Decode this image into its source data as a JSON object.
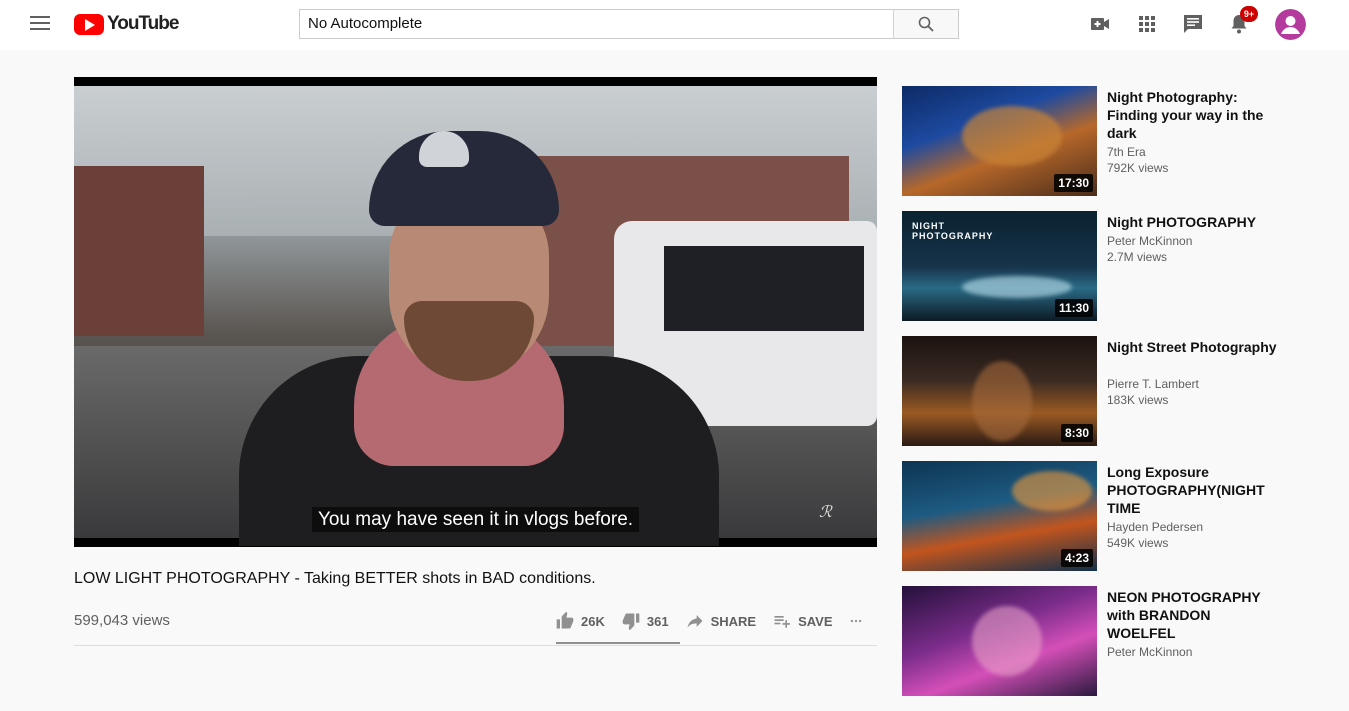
{
  "header": {
    "logo_text": "YouTube",
    "search_value": "No Autocomplete",
    "notification_count": "9+"
  },
  "video": {
    "caption": "You may have seen it in vlogs before.",
    "title": "LOW LIGHT PHOTOGRAPHY - Taking BETTER shots in BAD conditions.",
    "views": "599,043 views",
    "likes": "26K",
    "dislikes": "361",
    "share_label": "SHARE",
    "save_label": "SAVE"
  },
  "recommendations": [
    {
      "title": "Night Photography: Finding your way in the dark",
      "channel": "7th Era",
      "views": "792K views",
      "duration": "17:30"
    },
    {
      "title": "Night PHOTOGRAPHY",
      "channel": "Peter McKinnon",
      "views": "2.7M views",
      "duration": "11:30",
      "thumb_text": "NIGHT PHOTOGRAPHY"
    },
    {
      "title": "Night Street Photography",
      "channel": "Pierre T. Lambert",
      "views": "183K views",
      "duration": "8:30"
    },
    {
      "title": "Long Exposure PHOTOGRAPHY(NIGHT TIME",
      "channel": "Hayden Pedersen",
      "views": "549K views",
      "duration": "4:23"
    },
    {
      "title": "NEON PHOTOGRAPHY with BRANDON WOELFEL",
      "channel": "Peter McKinnon",
      "views": "",
      "duration": ""
    }
  ]
}
